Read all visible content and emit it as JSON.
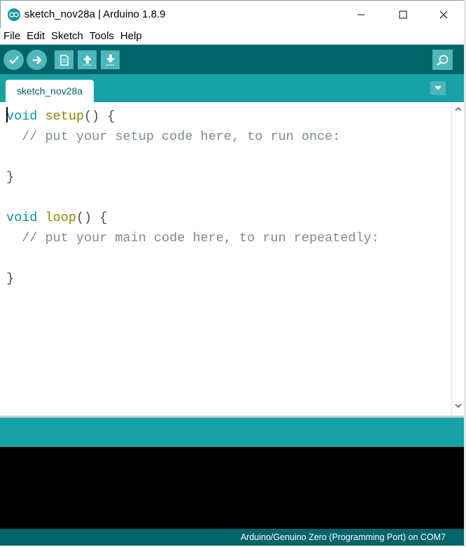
{
  "window": {
    "title": "sketch_nov28a | Arduino 1.8.9"
  },
  "menu": {
    "items": [
      "File",
      "Edit",
      "Sketch",
      "Tools",
      "Help"
    ]
  },
  "toolbar": {
    "buttons": [
      "verify-icon",
      "upload-arrow-icon",
      "new-file-icon",
      "open-up-arrow-icon",
      "save-down-arrow-icon"
    ],
    "monitor": "serial-monitor-icon"
  },
  "tabs": {
    "active": "sketch_nov28a"
  },
  "editor": {
    "lines": [
      {
        "kw": "void",
        "fn": "setup",
        "rest": "() {"
      },
      {
        "comment": "  // put your setup code here, to run once:"
      },
      {
        "text": ""
      },
      {
        "text": "}"
      },
      {
        "text": ""
      },
      {
        "kw": "void",
        "fn": "loop",
        "rest": "() {"
      },
      {
        "comment": "  // put your main code here, to run repeatedly:"
      },
      {
        "text": ""
      },
      {
        "text": "}"
      }
    ]
  },
  "footer": {
    "board": "Arduino/Genuino Zero (Programming Port) on COM7"
  },
  "colors": {
    "toolbar": "#006468",
    "tabbar": "#17a1a5",
    "button": "#4db7bb"
  }
}
